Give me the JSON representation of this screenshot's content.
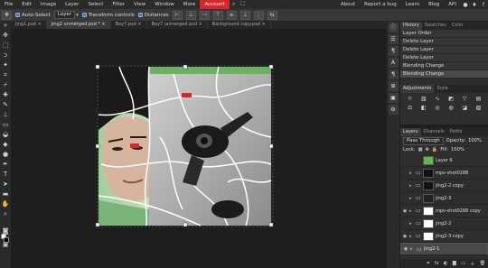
{
  "menu": {
    "items": [
      "File",
      "Edit",
      "Image",
      "Layer",
      "Select",
      "Filter",
      "View",
      "Window",
      "More"
    ],
    "account": "Account",
    "right_items": [
      "About",
      "Report a bug",
      "Learn",
      "Blog",
      "API"
    ]
  },
  "options": {
    "auto_select": "Auto-Select",
    "target": "Layer",
    "transform_controls": "Transform controls",
    "distances": "Distances"
  },
  "tabs": [
    "jing1.psd",
    "jing2 unmerged.psd *",
    "Boy7.psd",
    "Boy7 unmerged.psd",
    "Background copy.psd"
  ],
  "history": {
    "tabs": [
      "History",
      "Swatches",
      "Color"
    ],
    "items": [
      "Layer Order",
      "Delete Layer",
      "Delete Layer",
      "Delete Layer",
      "Blending Change",
      "Blending Change"
    ]
  },
  "adjustments": {
    "tabs": [
      "Adjustments",
      "Style"
    ]
  },
  "layers": {
    "tabs": [
      "Layers",
      "Channels",
      "Paths"
    ],
    "blend_mode": "Pass Through",
    "opacity_label": "Opacity:",
    "opacity": "100%",
    "lock_label": "Lock:",
    "fill_label": "Fill:",
    "fill": "100%",
    "items": [
      {
        "name": "Layer 6",
        "visible": false,
        "type": "layer",
        "thumb": "#5fb94a"
      },
      {
        "name": "mpv-shot0288",
        "visible": false,
        "type": "group"
      },
      {
        "name": "jing2-2 copy",
        "visible": false,
        "type": "group"
      },
      {
        "name": "jing2-3",
        "visible": false,
        "type": "group"
      },
      {
        "name": "mpv-shot0288 copy",
        "visible": true,
        "type": "group"
      },
      {
        "name": "jing2-2",
        "visible": false,
        "type": "group"
      },
      {
        "name": "jing2-3 copy",
        "visible": true,
        "type": "group"
      },
      {
        "name": "jing2-1",
        "visible": true,
        "type": "group",
        "selected": true
      }
    ]
  },
  "canvas": {
    "label_1": "",
    "label_2": ""
  }
}
